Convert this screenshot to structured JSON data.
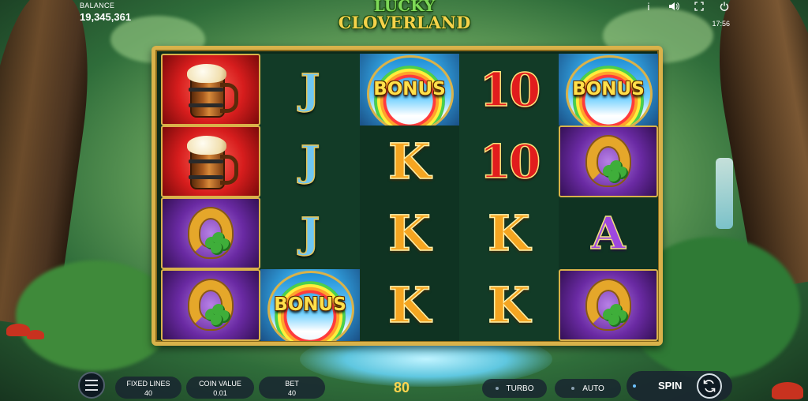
{
  "game": {
    "logo_line1": "LUCKY",
    "logo_line2": "CLOVERLAND"
  },
  "hud": {
    "balance_label": "BALANCE",
    "balance_value": "19,345,361",
    "clock": "17:56",
    "icons": [
      "info-icon",
      "sound-icon",
      "fullscreen-icon",
      "power-icon"
    ],
    "info_glyph": "i"
  },
  "reels": [
    [
      "beer-mug",
      "beer-mug",
      "horseshoe",
      "horseshoe"
    ],
    [
      "J",
      "J",
      "J",
      "bonus"
    ],
    [
      "bonus",
      "K",
      "K",
      "K"
    ],
    [
      "10",
      "10",
      "K",
      "K"
    ],
    [
      "bonus",
      "horseshoe",
      "A",
      "horseshoe"
    ]
  ],
  "symbols": {
    "bonus_text": "BONUS",
    "J": "J",
    "K": "K",
    "A": "A",
    "ten": "10"
  },
  "controls": {
    "fixed_lines_label": "FIXED LINES",
    "fixed_lines_value": "40",
    "coin_value_label": "COIN VALUE",
    "coin_value_value": "0.01",
    "bet_label": "BET",
    "bet_value": "40",
    "total_bet": "80",
    "turbo_label": "TURBO",
    "auto_label": "AUTO",
    "spin_label": "SPIN"
  },
  "colors": {
    "frame_gold": "#d9b24a",
    "bet_amount": "#ffd54f"
  }
}
